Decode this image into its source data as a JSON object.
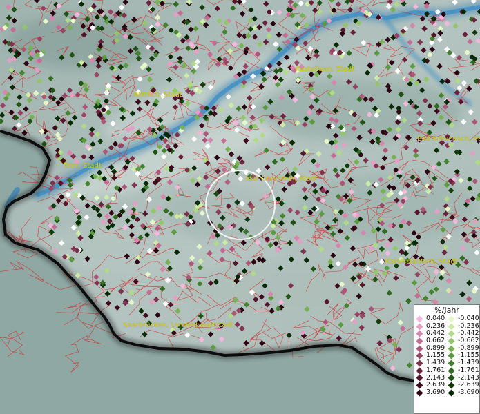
{
  "map": {
    "unit": "%/Jahr",
    "colors": {
      "terrain": "#9bb0ac",
      "border": "#0c0c0c",
      "boundaries": "#d42a2a",
      "river": "#3e8fc4",
      "label": "#d8d200"
    },
    "cities": [
      {
        "name": "Kastellaun, Stadt"
      },
      {
        "name": "Wittlich, Stadt"
      },
      {
        "name": "Bad Kreuznach, Stadt"
      },
      {
        "name": "Trier, Stadt"
      },
      {
        "name": "Idar-Oberstein, Stadt"
      },
      {
        "name": "Kaiserslautern, Stadt"
      },
      {
        "name": "Saarbrücken, Landeshauptstadt"
      }
    ],
    "legend": {
      "title": "%/Jahr",
      "positive": [
        {
          "value": "0.040",
          "color": "#f2b8dc"
        },
        {
          "value": "0.236",
          "color": "#e59fc5"
        },
        {
          "value": "0.442",
          "color": "#d785ad"
        },
        {
          "value": "0.662",
          "color": "#c46d94"
        },
        {
          "value": "0.899",
          "color": "#ad587b"
        },
        {
          "value": "1.155",
          "color": "#974563"
        },
        {
          "value": "1.439",
          "color": "#80334e"
        },
        {
          "value": "1.761",
          "color": "#6b233b"
        },
        {
          "value": "2.143",
          "color": "#55152a"
        },
        {
          "value": "2.639",
          "color": "#3f0b1c"
        },
        {
          "value": "3.690",
          "color": "#2a0410"
        }
      ],
      "negative": [
        {
          "value": "-0.040",
          "color": "#e6f7c8"
        },
        {
          "value": "-0.236",
          "color": "#cdeba6"
        },
        {
          "value": "-0.442",
          "color": "#b1da86"
        },
        {
          "value": "-0.662",
          "color": "#93c66a"
        },
        {
          "value": "-0.899",
          "color": "#77b154"
        },
        {
          "value": "-1.155",
          "color": "#5c9a40"
        },
        {
          "value": "-1.439",
          "color": "#458330"
        },
        {
          "value": "-1.761",
          "color": "#306b21"
        },
        {
          "value": "-2.143",
          "color": "#1f5415"
        },
        {
          "value": "-2.639",
          "color": "#123d0b"
        },
        {
          "value": "-3.690",
          "color": "#072a04"
        }
      ]
    }
  }
}
